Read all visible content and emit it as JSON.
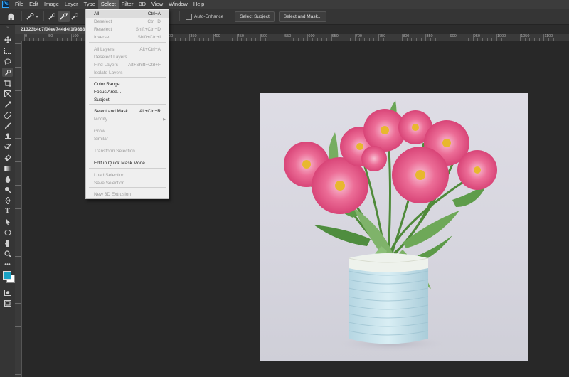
{
  "menubar": {
    "logo": "Ps",
    "items": [
      "File",
      "Edit",
      "Image",
      "Layer",
      "Type",
      "Select",
      "Filter",
      "3D",
      "View",
      "Window",
      "Help"
    ],
    "active": "Select"
  },
  "options": {
    "auto_enhance": "Auto-Enhance",
    "select_subject": "Select Subject",
    "select_and_mask": "Select and Mask..."
  },
  "document": {
    "tab_title": "21323b4c7f04ee744d4f1f9888c"
  },
  "ruler": {
    "h_labels": [
      "0",
      "50",
      "100",
      "150",
      "200",
      "250",
      "300",
      "350",
      "400",
      "450",
      "500",
      "550",
      "600",
      "650",
      "700",
      "750",
      "800",
      "850",
      "900",
      "950",
      "1000",
      "1050",
      "1100"
    ]
  },
  "select_menu": {
    "items": [
      {
        "label": "All",
        "shortcut": "Ctrl+A",
        "enabled": true
      },
      {
        "label": "Deselect",
        "shortcut": "Ctrl+D",
        "enabled": false
      },
      {
        "label": "Reselect",
        "shortcut": "Shift+Ctrl+D",
        "enabled": false
      },
      {
        "label": "Inverse",
        "shortcut": "Shift+Ctrl+I",
        "enabled": false
      },
      {
        "label": "All Layers",
        "shortcut": "Alt+Ctrl+A",
        "enabled": false
      },
      {
        "label": "Deselect Layers",
        "shortcut": "",
        "enabled": false
      },
      {
        "label": "Find Layers",
        "shortcut": "Alt+Shift+Ctrl+F",
        "enabled": false
      },
      {
        "label": "Isolate Layers",
        "shortcut": "",
        "enabled": false
      },
      {
        "label": "Color Range...",
        "shortcut": "",
        "enabled": true
      },
      {
        "label": "Focus Area...",
        "shortcut": "",
        "enabled": true
      },
      {
        "label": "Subject",
        "shortcut": "",
        "enabled": true
      },
      {
        "label": "Select and Mask...",
        "shortcut": "Alt+Ctrl+R",
        "enabled": true
      },
      {
        "label": "Modify",
        "shortcut": "",
        "enabled": false,
        "submenu": true
      },
      {
        "label": "Grow",
        "shortcut": "",
        "enabled": false
      },
      {
        "label": "Similar",
        "shortcut": "",
        "enabled": false
      },
      {
        "label": "Transform Selection",
        "shortcut": "",
        "enabled": false
      },
      {
        "label": "Edit in Quick Mask Mode",
        "shortcut": "",
        "enabled": true
      },
      {
        "label": "Load Selection...",
        "shortcut": "",
        "enabled": false
      },
      {
        "label": "Save Selection...",
        "shortcut": "",
        "enabled": false
      },
      {
        "label": "New 3D Extrusion",
        "shortcut": "",
        "enabled": false
      }
    ]
  },
  "colors": {
    "foreground": "#1aa3c6",
    "background": "#ffffff",
    "accent": "#31a8ff"
  }
}
